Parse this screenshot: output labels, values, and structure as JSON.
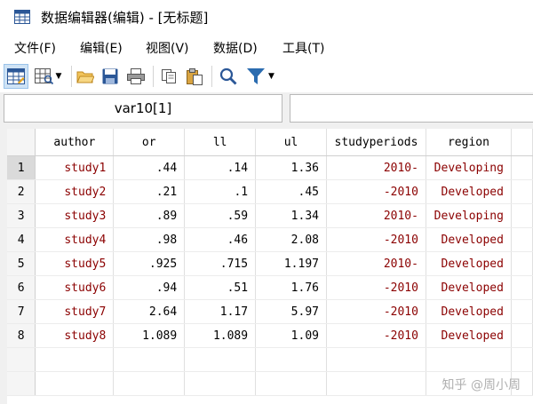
{
  "window": {
    "title": "数据编辑器(编辑) - [无标题]"
  },
  "menu": {
    "items": [
      "文件(F)",
      "编辑(E)",
      "视图(V)",
      "数据(D)",
      "工具(T)"
    ]
  },
  "toolbar": {
    "icons": [
      "edit-mode-icon",
      "browse-mode-icon",
      "open-folder-icon",
      "save-icon",
      "print-icon",
      "copy-icon",
      "paste-icon",
      "search-icon",
      "filter-icon"
    ]
  },
  "varbar": {
    "cell_name": "var10[1]",
    "cell_value": ""
  },
  "grid": {
    "columns": [
      "author",
      "or",
      "ll",
      "ul",
      "studyperiods",
      "region"
    ],
    "rows": [
      {
        "n": "1",
        "cells": [
          "study1",
          ".44",
          ".14",
          "1.36",
          "2010-",
          "Developing"
        ]
      },
      {
        "n": "2",
        "cells": [
          "study2",
          ".21",
          ".1",
          ".45",
          "-2010",
          "Developed"
        ]
      },
      {
        "n": "3",
        "cells": [
          "study3",
          ".89",
          ".59",
          "1.34",
          "2010-",
          "Developing"
        ]
      },
      {
        "n": "4",
        "cells": [
          "study4",
          ".98",
          ".46",
          "2.08",
          "-2010",
          "Developed"
        ]
      },
      {
        "n": "5",
        "cells": [
          "study5",
          ".925",
          ".715",
          "1.197",
          "2010-",
          "Developed"
        ]
      },
      {
        "n": "6",
        "cells": [
          "study6",
          ".94",
          ".51",
          "1.76",
          "-2010",
          "Developed"
        ]
      },
      {
        "n": "7",
        "cells": [
          "study7",
          "2.64",
          "1.17",
          "5.97",
          "-2010",
          "Developed"
        ]
      },
      {
        "n": "8",
        "cells": [
          "study8",
          "1.089",
          "1.089",
          "1.09",
          "-2010",
          "Developed"
        ]
      }
    ],
    "string_color": "#8b0000"
  },
  "watermark": "知乎 @周小周"
}
